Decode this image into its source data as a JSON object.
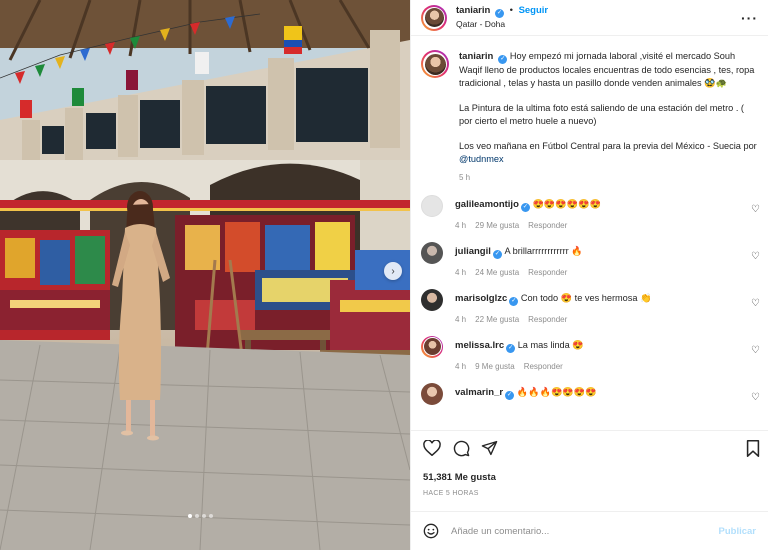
{
  "post": {
    "username": "taniarin",
    "follow_label": "Seguir",
    "separator": "•",
    "location": "Qatar - Doha",
    "more_icon": "more-horizontal-icon"
  },
  "caption": {
    "username": "taniarin",
    "paragraphs": [
      "Hoy empezó mi jornada laboral ,visité el mercado Souh Waqif lleno de productos locales encuentras de todo esencias , tes, ropa tradicional , telas y hasta un pasillo donde venden animales 🥸🐢",
      "La Pintura de la ultima foto está saliendo de una estación del metro . ( por cierto el metro huele a nuevo)"
    ],
    "last_line_text": "Los veo mañana en Fútbol Central para la previa del México - Suecia por ",
    "mention": "@tudnmex",
    "time": "5 h"
  },
  "comments": [
    {
      "username": "galileamontijo",
      "verified": true,
      "text": "😍😍😍😍😍😍",
      "time": "4 h",
      "likes": "29 Me gusta",
      "reply": "Responder",
      "avatar_color": "#d9d9d9"
    },
    {
      "username": "juliangil",
      "verified": true,
      "text": "A brillarrrrrrrrrrrr 🔥",
      "time": "4 h",
      "likes": "24 Me gusta",
      "reply": "Responder",
      "avatar_color": "#bdbdbd"
    },
    {
      "username": "marisolglzc",
      "verified": true,
      "text": "Con todo 😍 te ves hermosa 👏",
      "time": "4 h",
      "likes": "22 Me gusta",
      "reply": "Responder",
      "avatar_color": "#5a5a5a"
    },
    {
      "username": "melissa.lrc",
      "verified": true,
      "text": "La mas linda 😍",
      "time": "4 h",
      "likes": "9 Me gusta",
      "reply": "Responder",
      "avatar_color": "#7d5a50"
    },
    {
      "username": "valmarin_r",
      "verified": true,
      "text": "🔥🔥🔥😍😍😍😍",
      "time": "",
      "likes": "",
      "reply": "",
      "avatar_color": "#a57b6a"
    }
  ],
  "actions": {
    "like_icon": "heart-icon",
    "comment_icon": "comment-icon",
    "share_icon": "share-icon",
    "save_icon": "bookmark-icon"
  },
  "likes_text": "51,381 Me gusta",
  "time_ago": "HACE 5 HORAS",
  "add_comment": {
    "emoji_icon": "emoji-icon",
    "placeholder": "Añade un comentario...",
    "publish_label": "Publicar"
  },
  "colors": {
    "link_blue": "#0095f6",
    "verified_blue": "#3897f0",
    "muted": "#8e8e8e",
    "publish_disabled": "#b2dffc"
  },
  "carousel": {
    "count": 4,
    "active": 1
  }
}
